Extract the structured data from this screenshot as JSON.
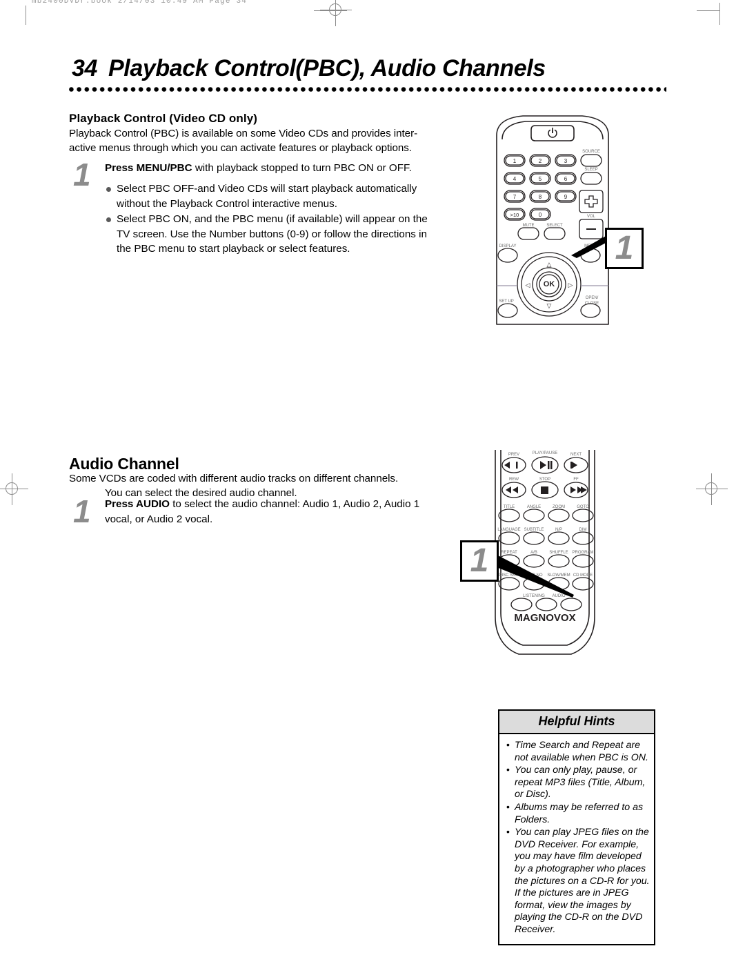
{
  "scan": {
    "header_line": "mb2400DVDr.book   2/14/03  10:49 AM  Page 34"
  },
  "header": {
    "page_number": "34",
    "title": "Playback Control(PBC), Audio Channels"
  },
  "sections": [
    {
      "id": "playback-control",
      "heading": "Playback Control  (Video CD only)",
      "intro": "Playback Control (PBC) is available on some Video CDs and provides inter-active menus through which you can activate features or playback options.",
      "intro_lines": [
        "Playback Control (PBC) is available on some Video CDs and provides inter-",
        "active menus through which you can activate features or playback options."
      ],
      "step_number": "1",
      "step_text_bold": "Press MENU/PBC",
      "step_text_rest": " with playback stopped to turn PBC ON or OFF.",
      "bullets": [
        "Select PBC OFF-and Video CDs will start playback automatically without the Playback Control interactive menus.",
        "Select PBC ON, and the PBC menu (if available) will appear on the TV screen. Use the Number buttons (0-9) or follow the directions in the PBC menu to start playback or select features."
      ]
    },
    {
      "id": "audio-channel",
      "heading": "Audio Channel",
      "intro_lines": [
        "Some VCDs are coded with different audio tracks on different channels.",
        "You can select the desired audio channel."
      ],
      "step_number": "1",
      "step_text_bold": "Press AUDIO",
      "step_text_rest": " to select the audio channel: Audio 1, Audio 2, Audio 1 vocal, or Audio 2 vocal."
    }
  ],
  "helpful_hints": {
    "title": "Helpful Hints",
    "items": [
      "Time Search and Repeat are not available when PBC is ON.",
      "You can only play, pause, or repeat MP3 files (Title, Album, or Disc).",
      "Albums may be referred to as Folders.",
      "You can play JPEG files on the DVD Receiver. For example, you may have film developed by a photographer who places the pictures on a CD-R for you. If the pictures are in JPEG format, view the images by playing the CD-R on the DVD Receiver."
    ]
  },
  "callouts": [
    {
      "id": "callout-menu-pbc",
      "label": "1",
      "points_to": "MENU button"
    },
    {
      "id": "callout-audio",
      "label": "1",
      "points_to": "AUDIO button"
    }
  ],
  "remote_top": {
    "name": "remote-control-upper",
    "power_icon": "power-icon",
    "number_keys": [
      "1",
      "2",
      "3",
      "4",
      "5",
      "6",
      "7",
      "8",
      "9",
      ">10",
      "0"
    ],
    "side_keys": [
      "SOURCE",
      "SLEEP"
    ],
    "volume_label": "VOL",
    "volume_keys": [
      "+",
      "–"
    ],
    "small_keys": [
      "MUTE",
      "SELECT"
    ],
    "lower_keys": [
      "DISPLAY",
      "MENU",
      "SET UP",
      "OPEN/ CLOSE"
    ],
    "dpad": {
      "up": "△",
      "down": "▽",
      "left": "◁",
      "right": "▷",
      "center": "OK"
    }
  },
  "remote_bottom": {
    "name": "remote-control-lower",
    "transport_rows": [
      [
        {
          "label": "PREV",
          "glyph": "◀❘"
        },
        {
          "label": "PLAY/PAUSE",
          "glyph": "▶❘❘"
        },
        {
          "label": "NEXT",
          "glyph": "❘▶"
        }
      ],
      [
        {
          "label": "REW",
          "glyph": "◀◀"
        },
        {
          "label": "STOP",
          "glyph": "■"
        },
        {
          "label": "FF",
          "glyph": "▶▶"
        }
      ]
    ],
    "function_rows": [
      [
        "TITLE",
        "ANGLE",
        "ZOOM",
        "GOTO"
      ],
      [
        "LANGUAGE",
        "SUBTITLE",
        "N/P",
        "DIM"
      ],
      [
        "REPEAT",
        "A/B",
        "SHUFFLE",
        "PROGRAM"
      ],
      [
        "DISC SKIP",
        "DISC NO",
        "SLOW/MEM",
        "CD MODE"
      ]
    ],
    "bottom_keys": [
      "",
      "LISTENING",
      "AUDIO"
    ],
    "brand": "MAGNOVOX"
  },
  "colors": {
    "ink": "#000000",
    "step_gray": "#8c8c8c",
    "hint_header_fill": "#dcdcdc",
    "bullet_gray": "#5a5a5a",
    "crop_mark": "#8b8b8b"
  }
}
